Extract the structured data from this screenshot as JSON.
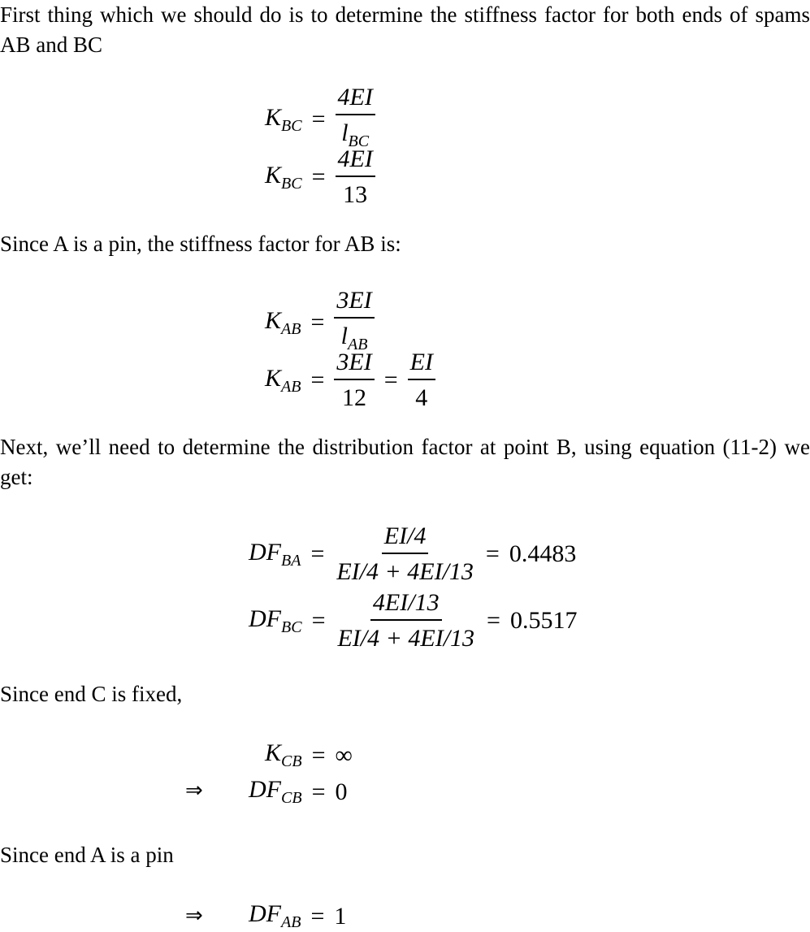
{
  "paragraphs": {
    "p1": "First thing which we should do is to determine the stiffness factor for both ends of spams AB and BC",
    "p2": "Since A is a pin, the stiffness factor for AB is:",
    "p3": "Next, we’ll need to determine the distribution factor at point B, using equation (11-2) we get:",
    "p4": "Since end C is fixed,",
    "p5": "Since end A is a pin"
  },
  "equations": {
    "k_bc_1": {
      "lhs": "K",
      "lhs_sub": "BC",
      "num": "4EI",
      "den": "l",
      "den_sub": "BC"
    },
    "k_bc_2": {
      "lhs": "K",
      "lhs_sub": "BC",
      "num": "4EI",
      "den": "13"
    },
    "k_ab_1": {
      "lhs": "K",
      "lhs_sub": "AB",
      "num": "3EI",
      "den": "l",
      "den_sub": "AB"
    },
    "k_ab_2": {
      "lhs": "K",
      "lhs_sub": "AB",
      "num": "3EI",
      "den": "12",
      "num2": "EI",
      "den2": "4"
    },
    "df_ba": {
      "lhs": "DF",
      "lhs_sub": "BA",
      "num": "EI/4",
      "den": "EI/4 + 4EI/13",
      "result": "0.4483"
    },
    "df_bc": {
      "lhs": "DF",
      "lhs_sub": "BC",
      "num": "4EI/13",
      "den": "EI/4 + 4EI/13",
      "result": "0.5517"
    },
    "k_cb": {
      "lhs": "K",
      "lhs_sub": "CB",
      "result": "∞"
    },
    "df_cb": {
      "implies": "⇒",
      "lhs": "DF",
      "lhs_sub": "CB",
      "result": "0"
    },
    "df_ab": {
      "implies": "⇒",
      "lhs": "DF",
      "lhs_sub": "AB",
      "result": "1"
    }
  },
  "symbols": {
    "equals": "="
  }
}
